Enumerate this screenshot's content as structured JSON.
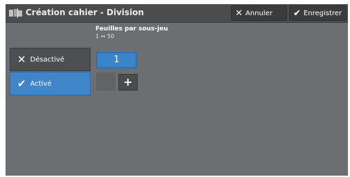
{
  "header": {
    "title": "Création cahier - Division",
    "icon": "book-split-icon",
    "cancel_icon": "x-icon",
    "cancel_label": "Annuler",
    "save_icon": "check-icon",
    "save_label": "Enregistrer"
  },
  "options": [
    {
      "label": "Désactivé",
      "icon": "x-icon",
      "selected": false
    },
    {
      "label": "Activé",
      "icon": "check-icon",
      "selected": true
    }
  ],
  "sheets_per_set": {
    "label": "Feuilles par sous-jeu",
    "range": "1 ↔ 50",
    "value": "1",
    "increment_label": "+"
  },
  "colors": {
    "panel_bg": "#6d6e70",
    "header_bg": "#4b4c4e",
    "selected_blue": "#3f86c8",
    "button_dark": "#3a3b3d"
  }
}
